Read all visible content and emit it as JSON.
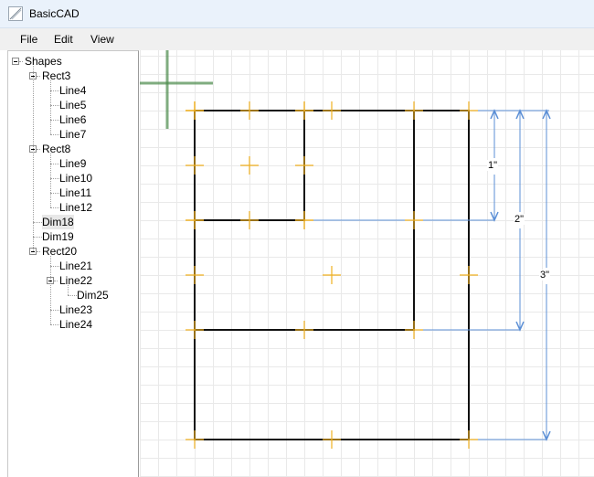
{
  "window": {
    "title": "BasicCAD"
  },
  "menu": [
    {
      "label": "File"
    },
    {
      "label": "Edit"
    },
    {
      "label": "View"
    }
  ],
  "tree": [
    {
      "label": "Shapes",
      "depth": 0,
      "expandable": true,
      "selected": false
    },
    {
      "label": "Rect3",
      "depth": 1,
      "expandable": true,
      "selected": false
    },
    {
      "label": "Line4",
      "depth": 2,
      "expandable": false,
      "selected": false
    },
    {
      "label": "Line5",
      "depth": 2,
      "expandable": false,
      "selected": false
    },
    {
      "label": "Line6",
      "depth": 2,
      "expandable": false,
      "selected": false
    },
    {
      "label": "Line7",
      "depth": 2,
      "expandable": false,
      "selected": false
    },
    {
      "label": "Rect8",
      "depth": 1,
      "expandable": true,
      "selected": false
    },
    {
      "label": "Line9",
      "depth": 2,
      "expandable": false,
      "selected": false
    },
    {
      "label": "Line10",
      "depth": 2,
      "expandable": false,
      "selected": false
    },
    {
      "label": "Line11",
      "depth": 2,
      "expandable": false,
      "selected": false
    },
    {
      "label": "Line12",
      "depth": 2,
      "expandable": false,
      "selected": false
    },
    {
      "label": "Dim18",
      "depth": 1,
      "expandable": false,
      "selected": true
    },
    {
      "label": "Dim19",
      "depth": 1,
      "expandable": false,
      "selected": false
    },
    {
      "label": "Rect20",
      "depth": 1,
      "expandable": true,
      "selected": false
    },
    {
      "label": "Line21",
      "depth": 2,
      "expandable": false,
      "selected": false
    },
    {
      "label": "Line22",
      "depth": 2,
      "expandable": true,
      "selected": false
    },
    {
      "label": "Dim25",
      "depth": 3,
      "expandable": false,
      "selected": false
    },
    {
      "label": "Line23",
      "depth": 2,
      "expandable": false,
      "selected": false
    },
    {
      "label": "Line24",
      "depth": 2,
      "expandable": false,
      "selected": false
    }
  ],
  "dimensions": [
    {
      "label": "1\""
    },
    {
      "label": "2\""
    },
    {
      "label": "3\""
    }
  ],
  "colors": {
    "shape": "#111111",
    "handle": "#f0b020",
    "dimension": "#5b8fd6",
    "cursor": "#4a8a4a",
    "grid": "#e9e9e9"
  }
}
